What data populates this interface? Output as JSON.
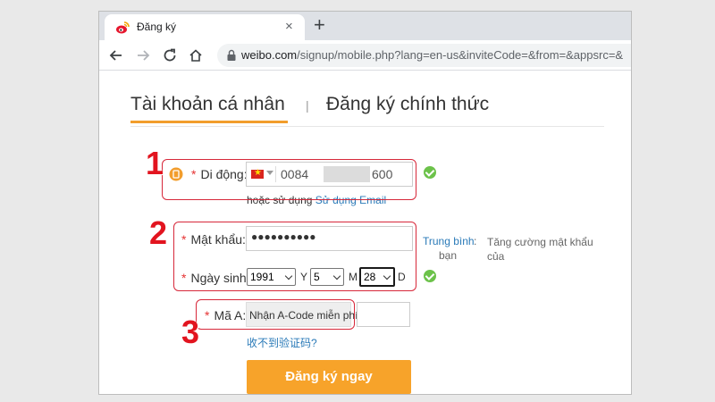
{
  "browser": {
    "tab_title": "Đăng ký",
    "new_tab": "+",
    "close": "×",
    "url_host": "weibo.com",
    "url_path": "/signup/mobile.php?lang=en-us&inviteCode=&from=&appsrc=&"
  },
  "page": {
    "tab_personal": "Tài khoản cá nhân",
    "tab_separator": "|",
    "tab_official": "Đăng ký chính thức"
  },
  "form": {
    "required_mark": "*",
    "phone_label": "Di động:",
    "phone_prefix": "0084",
    "phone_suffix": "600",
    "alt_prefix": "hoặc sử dụng",
    "alt_link": "Sử dụng Email",
    "password_label": "Mật khẩu:",
    "password_value": "●●●●●●●●●●",
    "strength": "Trung bình",
    "strength_colon": ":",
    "strength_tip_1": "Tăng cường mật khẩu của",
    "strength_tip_2": "bạn",
    "birth_label": "Ngày sinh:",
    "year": "1991",
    "year_unit": "Y",
    "month": "5",
    "month_unit": "M",
    "day": "28",
    "day_unit": "D",
    "code_label": "Mã A:",
    "code_button": "Nhận A-Code miễn phí",
    "code_help": "收不到验证码?",
    "submit": "Đăng ký ngay"
  },
  "annotations": [
    "1",
    "2",
    "3"
  ],
  "colors": {
    "accent": "#f7a32a",
    "underline": "#f29d2c",
    "link": "#2a7ab8",
    "annotation": "#e2141f"
  }
}
